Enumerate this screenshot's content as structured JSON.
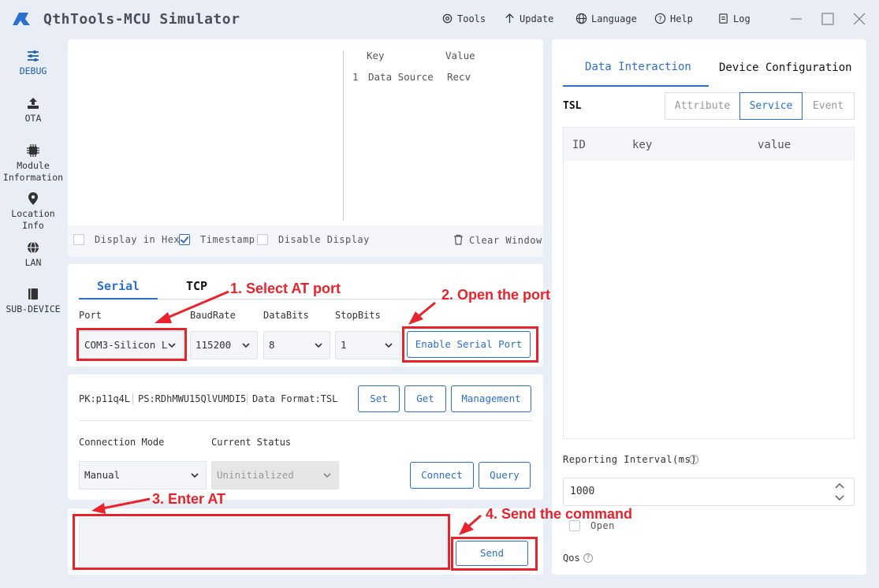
{
  "app": {
    "title": "QthTools-MCU Simulator"
  },
  "menu": {
    "tools": "Tools",
    "update": "Update",
    "language": "Language",
    "help": "Help",
    "log": "Log"
  },
  "sidebar": {
    "debug": "DEBUG",
    "ota": "OTA",
    "module_info": [
      "Module",
      "Information"
    ],
    "location_info": [
      "Location",
      "Info"
    ],
    "lan": "LAN",
    "sub_device": "SUB-DEVICE"
  },
  "log_panel": {
    "col_key": "Key",
    "col_value": "Value",
    "rows": [
      {
        "index": "1",
        "key": "Data Source",
        "value": "Recv"
      }
    ],
    "display_hex": "Display in Hex",
    "timestamp": "Timestamp",
    "disable_display": "Disable Display",
    "clear_window": "Clear Window",
    "display_hex_checked": false,
    "timestamp_checked": true,
    "disable_display_checked": false
  },
  "connection": {
    "tab_serial": "Serial",
    "tab_tcp": "TCP",
    "port_label": "Port",
    "baud_label": "BaudRate",
    "databits_label": "DataBits",
    "stopbits_label": "StopBits",
    "port_value": "COM3-Silicon L",
    "baud_value": "115200",
    "databits_value": "8",
    "stopbits_value": "1",
    "enable_button": "Enable Serial Port"
  },
  "product": {
    "pk": "PK:p11q4L",
    "ps": "PS:RDhMWU15QlVUMDI5",
    "format": "Data Format:TSL",
    "set_button": "Set",
    "get_button": "Get",
    "management_button": "Management",
    "mode_label": "Connection Mode",
    "status_label": "Current Status",
    "mode_value": "Manual",
    "status_value": "Uninitialized",
    "connect_button": "Connect",
    "query_button": "Query"
  },
  "send": {
    "button": "Send"
  },
  "right": {
    "tab_data": "Data Interaction",
    "tab_device": "Device Configuration",
    "tsl_label": "TSL",
    "seg_attribute": "Attribute",
    "seg_service": "Service",
    "seg_event": "Event",
    "col_id": "ID",
    "col_key": "key",
    "col_value": "value",
    "reporting_label": "Reporting Interval(ms)",
    "reporting_value": "1000",
    "open_label": "Open",
    "qos_label": "Qos"
  },
  "annotations": {
    "step1": "1. Select AT port",
    "step2": "2. Open the port",
    "step3": "3. Enter AT",
    "step4": "4. Send the command"
  },
  "colors": {
    "accent": "#2c6fcc",
    "annotation": "#e8232b",
    "background": "#e8edf6"
  }
}
